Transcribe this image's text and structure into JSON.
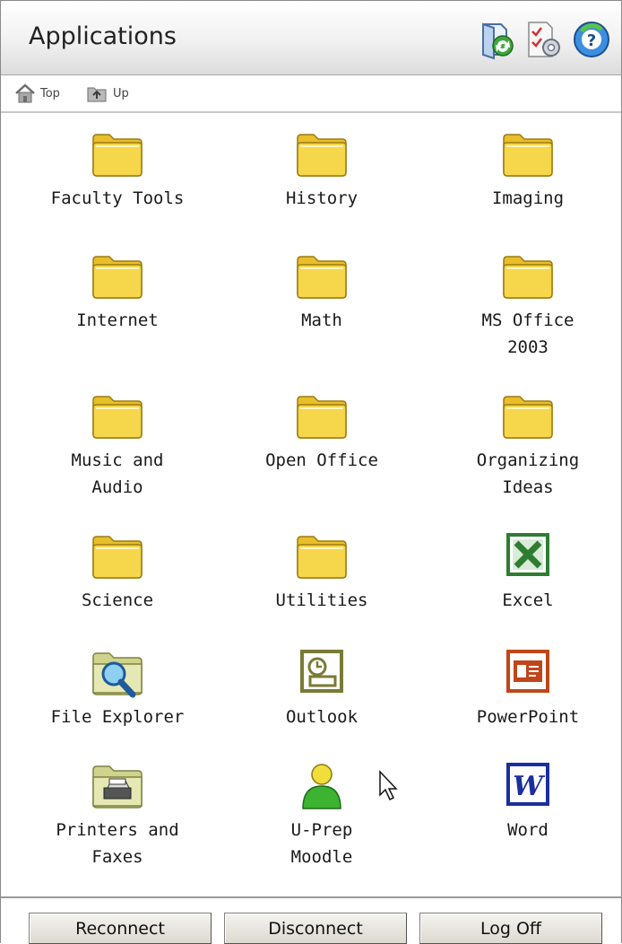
{
  "window": {
    "title": "Applications"
  },
  "toolbar": {
    "icons": [
      "refresh-icon",
      "settings-icon",
      "help-icon"
    ]
  },
  "nav": {
    "top_label": "Top",
    "up_label": "Up"
  },
  "apps": [
    {
      "label": "Faculty Tools",
      "icon": "folder-icon"
    },
    {
      "label": "History",
      "icon": "folder-icon"
    },
    {
      "label": "Imaging",
      "icon": "folder-icon"
    },
    {
      "label": "Internet",
      "icon": "folder-icon"
    },
    {
      "label": "Math",
      "icon": "folder-icon"
    },
    {
      "label": "MS Office\n2003",
      "icon": "folder-icon"
    },
    {
      "label": "Music and\nAudio",
      "icon": "folder-icon"
    },
    {
      "label": "Open Office",
      "icon": "folder-icon"
    },
    {
      "label": "Organizing\nIdeas",
      "icon": "folder-icon"
    },
    {
      "label": "Science",
      "icon": "folder-icon"
    },
    {
      "label": "Utilities",
      "icon": "folder-icon"
    },
    {
      "label": "Excel",
      "icon": "excel-icon"
    },
    {
      "label": "File Explorer",
      "icon": "file-explorer-icon"
    },
    {
      "label": "Outlook",
      "icon": "outlook-icon"
    },
    {
      "label": "PowerPoint",
      "icon": "powerpoint-icon"
    },
    {
      "label": "Printers and\nFaxes",
      "icon": "printers-icon"
    },
    {
      "label": "U-Prep\nMoodle",
      "icon": "moodle-user-icon"
    },
    {
      "label": "Word",
      "icon": "word-icon"
    }
  ],
  "footer": {
    "reconnect_label": "Reconnect",
    "disconnect_label": "Disconnect",
    "logoff_label": "Log Off"
  },
  "colors": {
    "folder": "#f6d64a",
    "excel": "#2e7d32",
    "outlook": "#7a7a35",
    "powerpoint": "#c0461a",
    "word": "#1a2f9e"
  }
}
